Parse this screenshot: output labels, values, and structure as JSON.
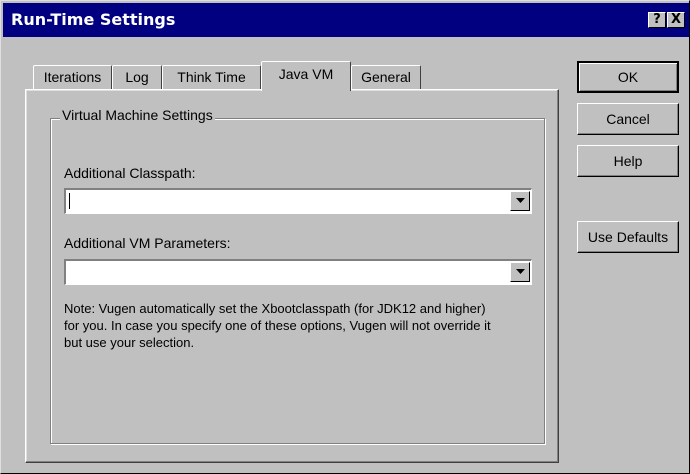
{
  "window": {
    "title": "Run-Time Settings",
    "help_glyph": "?",
    "close_glyph": "X"
  },
  "tabs": [
    {
      "label": "Iterations",
      "active": false
    },
    {
      "label": "Log",
      "active": false
    },
    {
      "label": "Think Time",
      "active": false
    },
    {
      "label": "Java VM",
      "active": true
    },
    {
      "label": "General",
      "active": false
    }
  ],
  "panel": {
    "group_title": "Virtual Machine Settings",
    "classpath_label": "Additional Classpath:",
    "classpath_value": "",
    "vm_params_label": "Additional VM Parameters:",
    "vm_params_value": "",
    "note": "Note: Vugen automatically set the  Xbootclasspath (for JDK12 and higher) for you. In case you specify one of these options, Vugen will not override it but use your selection."
  },
  "buttons": {
    "ok": "OK",
    "cancel": "Cancel",
    "help": "Help",
    "use_defaults": "Use Defaults"
  },
  "colors": {
    "title_bar": "#000080",
    "face": "#c0c0c0"
  }
}
